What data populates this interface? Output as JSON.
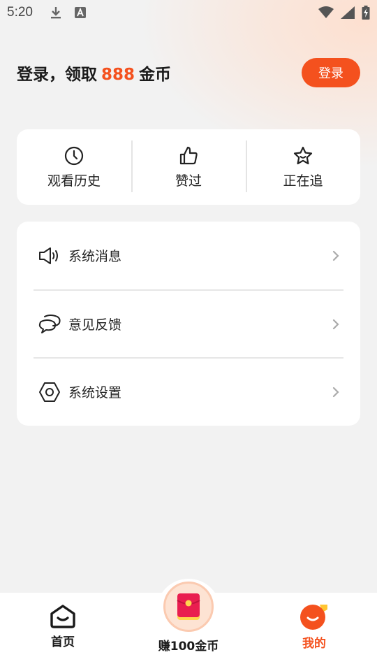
{
  "status_bar": {
    "time": "5:20"
  },
  "header": {
    "title_prefix": "登录，领取",
    "title_number": "888",
    "title_suffix": "金币",
    "login_label": "登录"
  },
  "quick_actions": [
    {
      "label": "观看历史",
      "icon": "clock-icon"
    },
    {
      "label": "赞过",
      "icon": "thumbs-up-icon"
    },
    {
      "label": "正在追",
      "icon": "star-icon"
    }
  ],
  "menu": [
    {
      "label": "系统消息",
      "icon": "speaker-icon"
    },
    {
      "label": "意见反馈",
      "icon": "chat-bubbles-icon"
    },
    {
      "label": "系统设置",
      "icon": "hexagon-settings-icon"
    }
  ],
  "bottom_nav": {
    "home_label": "首页",
    "earn_label": "赚100金币",
    "mine_label": "我的"
  },
  "colors": {
    "accent": "#f4511e",
    "background": "#f2f2f2",
    "card": "#ffffff"
  }
}
